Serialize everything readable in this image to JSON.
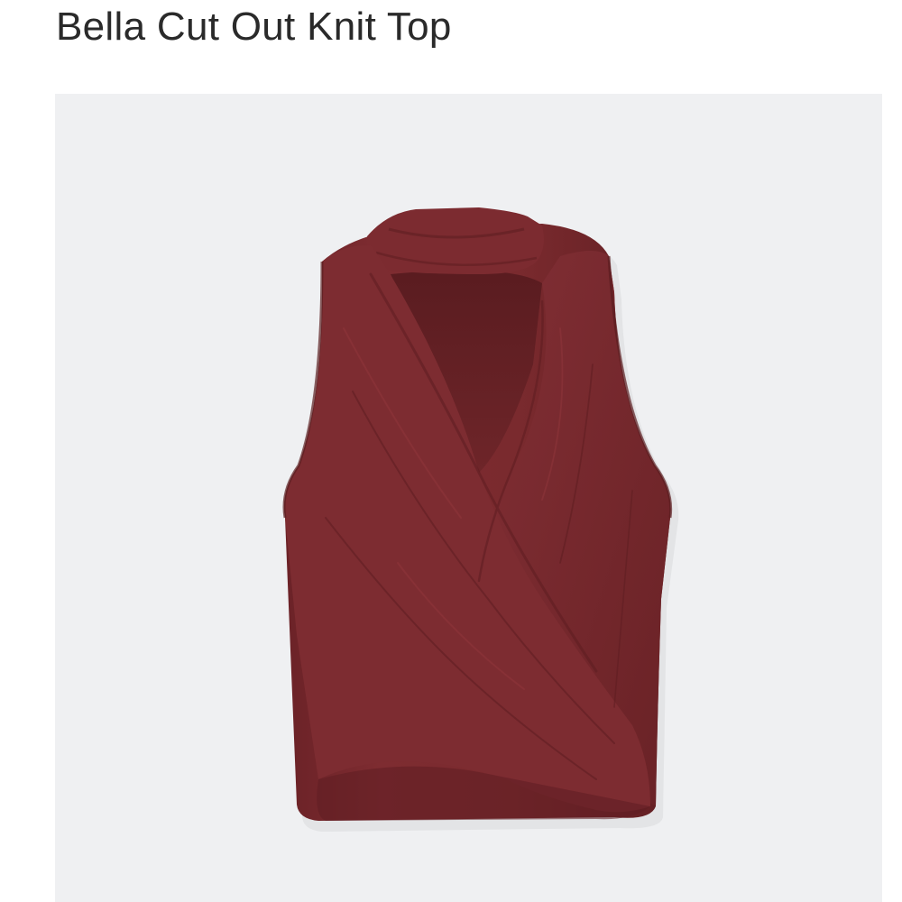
{
  "product": {
    "title": "Bella Cut Out Knit Top"
  },
  "product_image": {
    "subject": "sleeveless wrap-front mock-neck knit top with keyhole cut-out",
    "garment_color": "#7a2a2e",
    "background_color": "#eff0f2"
  }
}
